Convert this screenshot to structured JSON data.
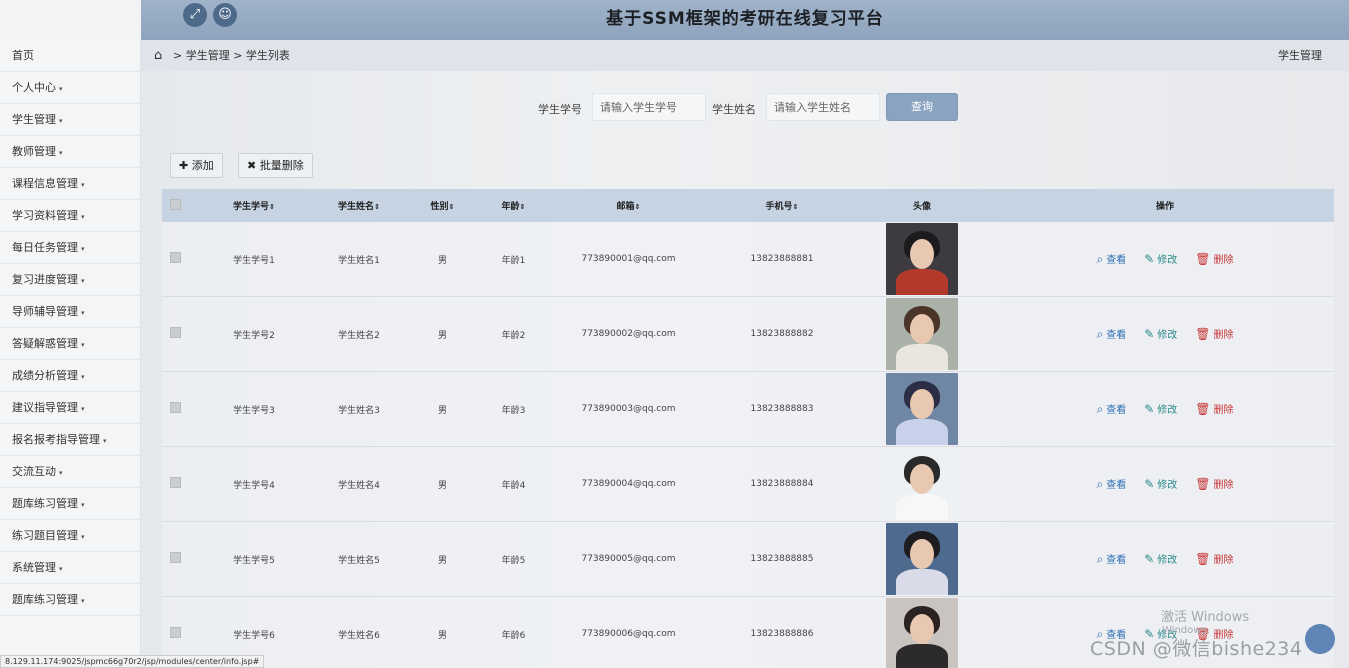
{
  "header": {
    "title": "基于SSM框架的考研在线复习平台",
    "icons": [
      "expand-icon",
      "user-icon"
    ]
  },
  "sidebar": {
    "items": [
      {
        "label": "首页",
        "caret": ""
      },
      {
        "label": "个人中心",
        "caret": "▾"
      },
      {
        "label": "学生管理",
        "caret": "▾"
      },
      {
        "label": "教师管理",
        "caret": "▾"
      },
      {
        "label": "课程信息管理",
        "caret": "▾"
      },
      {
        "label": "学习资料管理",
        "caret": "▾"
      },
      {
        "label": "每日任务管理",
        "caret": "▾"
      },
      {
        "label": "复习进度管理",
        "caret": "▾"
      },
      {
        "label": "导师辅导管理",
        "caret": "▾"
      },
      {
        "label": "答疑解惑管理",
        "caret": "▾"
      },
      {
        "label": "成绩分析管理",
        "caret": "▾"
      },
      {
        "label": "建议指导管理",
        "caret": "▾"
      },
      {
        "label": "报名报考指导管理",
        "caret": "▾"
      },
      {
        "label": "交流互动",
        "caret": "▾"
      },
      {
        "label": "题库练习管理",
        "caret": "▾"
      },
      {
        "label": "练习题目管理",
        "caret": "▾"
      },
      {
        "label": "系统管理",
        "caret": "▾"
      },
      {
        "label": "题库练习管理",
        "caret": "▾"
      }
    ]
  },
  "breadcrumb": {
    "path": "> 学生管理 > 学生列表",
    "right": "学生管理"
  },
  "search": {
    "id_label": "学生学号",
    "id_placeholder": "请输入学生学号",
    "name_label": "学生姓名",
    "name_placeholder": "请输入学生姓名",
    "query_label": "查询"
  },
  "actions": {
    "add_label": "添加",
    "batch_delete_label": "批量删除"
  },
  "table": {
    "headers": {
      "id": "学生学号",
      "name": "学生姓名",
      "sex": "性别",
      "age": "年龄",
      "email": "邮箱",
      "phone": "手机号",
      "avatar": "头像",
      "ops": "操作"
    },
    "sort_glyph": "⇕",
    "op_labels": {
      "view": "查看",
      "edit": "修改",
      "delete": "删除"
    },
    "rows": [
      {
        "id": "学生学号1",
        "name": "学生姓名1",
        "sex": "男",
        "age": "年龄1",
        "email": "773890001@qq.com",
        "phone": "13823888881",
        "bg": "#3d3b3f",
        "body": "#b33a2a",
        "hair": "#1b1a1c"
      },
      {
        "id": "学生学号2",
        "name": "学生姓名2",
        "sex": "男",
        "age": "年龄2",
        "email": "773890002@qq.com",
        "phone": "13823888882",
        "bg": "#aab1a9",
        "body": "#e8e6df",
        "hair": "#4a3528"
      },
      {
        "id": "学生学号3",
        "name": "学生姓名3",
        "sex": "男",
        "age": "年龄3",
        "email": "773890003@qq.com",
        "phone": "13823888883",
        "bg": "#6f86a4",
        "body": "#c9d0ea",
        "hair": "#2b2e45"
      },
      {
        "id": "学生学号4",
        "name": "学生姓名4",
        "sex": "男",
        "age": "年龄4",
        "email": "773890004@qq.com",
        "phone": "13823888884",
        "bg": "#eef1f3",
        "body": "#f7f7f7",
        "hair": "#2b2a2a"
      },
      {
        "id": "学生学号5",
        "name": "学生姓名5",
        "sex": "男",
        "age": "年龄5",
        "email": "773890005@qq.com",
        "phone": "13823888885",
        "bg": "#4e6a8f",
        "body": "#d9dce8",
        "hair": "#1e1c1e"
      },
      {
        "id": "学生学号6",
        "name": "学生姓名6",
        "sex": "男",
        "age": "年龄6",
        "email": "773890006@qq.com",
        "phone": "13823888886",
        "bg": "#c9c4bf",
        "body": "#2c2a2b",
        "hair": "#2a2220"
      }
    ]
  },
  "status_url": "8.129.11.174:9025/jspmc66g70r2/jsp/modules/center/info.jsp#",
  "watermark": {
    "line1": "激活 Windows",
    "line2": "Windows,",
    "csdn": "CSDN @微信bishe234"
  }
}
